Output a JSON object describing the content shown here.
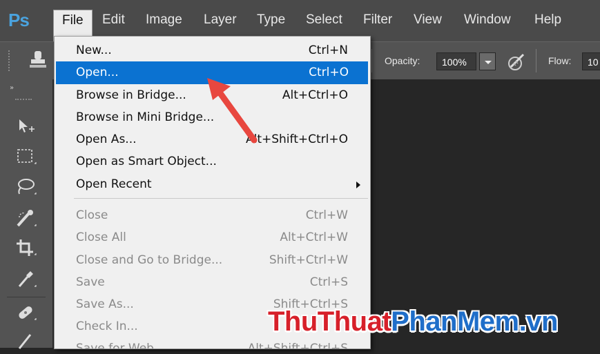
{
  "app": {
    "logo": "Ps"
  },
  "menubar": {
    "items": [
      {
        "label": "File"
      },
      {
        "label": "Edit"
      },
      {
        "label": "Image"
      },
      {
        "label": "Layer"
      },
      {
        "label": "Type"
      },
      {
        "label": "Select"
      },
      {
        "label": "Filter"
      },
      {
        "label": "View"
      },
      {
        "label": "Window"
      },
      {
        "label": "Help"
      }
    ],
    "active": "File"
  },
  "options_bar": {
    "opacity_label": "Opacity:",
    "opacity_value": "100%",
    "flow_label": "Flow:",
    "flow_value": "10"
  },
  "file_menu": {
    "items": [
      {
        "label": "New...",
        "shortcut": "Ctrl+N",
        "state": "normal"
      },
      {
        "label": "Open...",
        "shortcut": "Ctrl+O",
        "state": "highlighted"
      },
      {
        "label": "Browse in Bridge...",
        "shortcut": "Alt+Ctrl+O",
        "state": "normal"
      },
      {
        "label": "Browse in Mini Bridge...",
        "shortcut": "",
        "state": "normal"
      },
      {
        "label": "Open As...",
        "shortcut": "Alt+Shift+Ctrl+O",
        "state": "normal"
      },
      {
        "label": "Open as Smart Object...",
        "shortcut": "",
        "state": "normal"
      },
      {
        "label": "Open Recent",
        "shortcut": "",
        "state": "submenu"
      },
      {
        "label": "Close",
        "shortcut": "Ctrl+W",
        "state": "disabled"
      },
      {
        "label": "Close All",
        "shortcut": "Alt+Ctrl+W",
        "state": "disabled"
      },
      {
        "label": "Close and Go to Bridge...",
        "shortcut": "Shift+Ctrl+W",
        "state": "disabled"
      },
      {
        "label": "Save",
        "shortcut": "Ctrl+S",
        "state": "disabled"
      },
      {
        "label": "Save As...",
        "shortcut": "Shift+Ctrl+S",
        "state": "disabled"
      },
      {
        "label": "Check In...",
        "shortcut": "",
        "state": "disabled"
      },
      {
        "label": "Save for Web...",
        "shortcut": "Alt+Shift+Ctrl+S",
        "state": "disabled"
      }
    ]
  },
  "tools": [
    {
      "icon": "move-tool-icon"
    },
    {
      "icon": "marquee-tool-icon"
    },
    {
      "icon": "lasso-tool-icon"
    },
    {
      "icon": "quick-selection-tool-icon"
    },
    {
      "icon": "crop-tool-icon"
    },
    {
      "icon": "eyedropper-tool-icon"
    },
    {
      "icon": "healing-brush-tool-icon"
    },
    {
      "icon": "brush-tool-icon"
    }
  ],
  "watermark": {
    "part1": "ThuThuat",
    "part2": "PhanMem.vn"
  },
  "colors": {
    "menu_highlight": "#0b72d1",
    "ps_blue": "#4aa3df",
    "arrow_red": "#e8473f"
  }
}
